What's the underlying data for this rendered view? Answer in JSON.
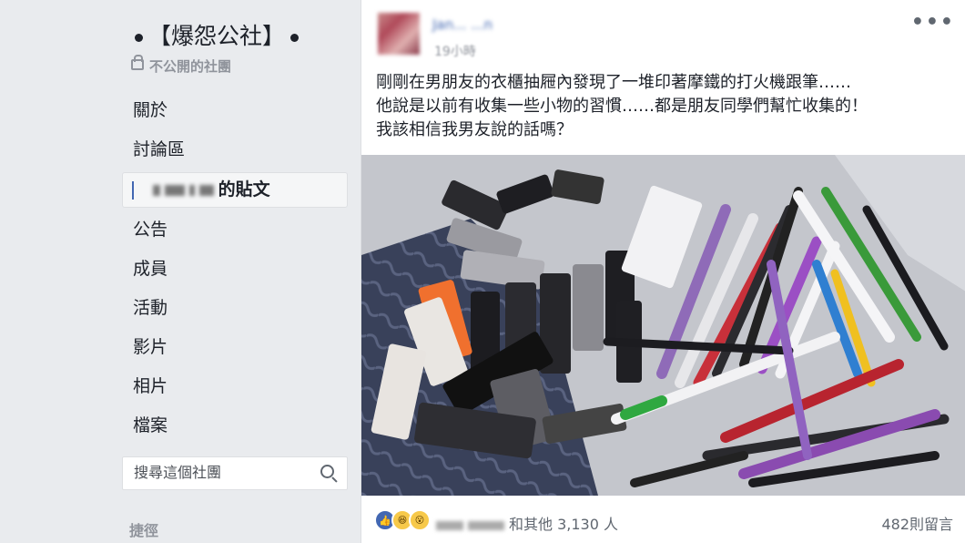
{
  "sidebar": {
    "group_name": "【爆怨公社】",
    "privacy_label": "不公開的社團",
    "nav": [
      {
        "label": "關於"
      },
      {
        "label": "討論區"
      },
      {
        "label": "的貼文"
      },
      {
        "label": "公告"
      },
      {
        "label": "成員"
      },
      {
        "label": "活動"
      },
      {
        "label": "影片"
      },
      {
        "label": "相片"
      },
      {
        "label": "檔案"
      }
    ],
    "search_placeholder": "搜尋這個社團",
    "shortcuts_label": "捷徑"
  },
  "post": {
    "author": "Jan... ...n",
    "time": "19小時",
    "more_label": "•••",
    "text_lines": [
      "剛剛在男朋友的衣櫃抽屜內發現了一堆印著摩鐵的打火機跟筆……",
      "他說是以前有收集一些小物的習慣……都是朋友同學們幫忙收集的！",
      "我該相信我男友說的話嗎？"
    ],
    "reactions_text": "和其他 3,130 人",
    "comments_label": "482則留言"
  }
}
